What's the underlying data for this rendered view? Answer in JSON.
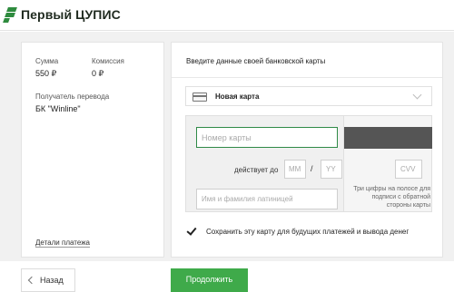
{
  "header": {
    "logo_text": "Первый ЦУПИС"
  },
  "summary": {
    "amount_label": "Сумма",
    "amount_value": "550 ₽",
    "fee_label": "Комиссия",
    "fee_value": "0 ₽",
    "recipient_label": "Получатель перевода",
    "recipient_value": "БК \"Winline\"",
    "details_link": "Детали платежа"
  },
  "card_form": {
    "title": "Введите данные своей банковской карты",
    "card_select": "Новая карта",
    "card_number_placeholder": "Номер  карты",
    "expiry_label": "действует до",
    "mm_placeholder": "MM",
    "slash": "/",
    "yy_placeholder": "YY",
    "name_placeholder": "Имя и фамилия латиницей",
    "cvv_placeholder": "CVV",
    "cvv_hint": "Три цифры на полосе для подписи с обратной стороны карты",
    "save_card_label": "Сохранить эту карту для будущих платежей и вывода денег",
    "save_card_checked": true
  },
  "footer": {
    "back_label": "Назад",
    "continue_label": "Продолжить",
    "continue_color": "#3faa4a"
  }
}
